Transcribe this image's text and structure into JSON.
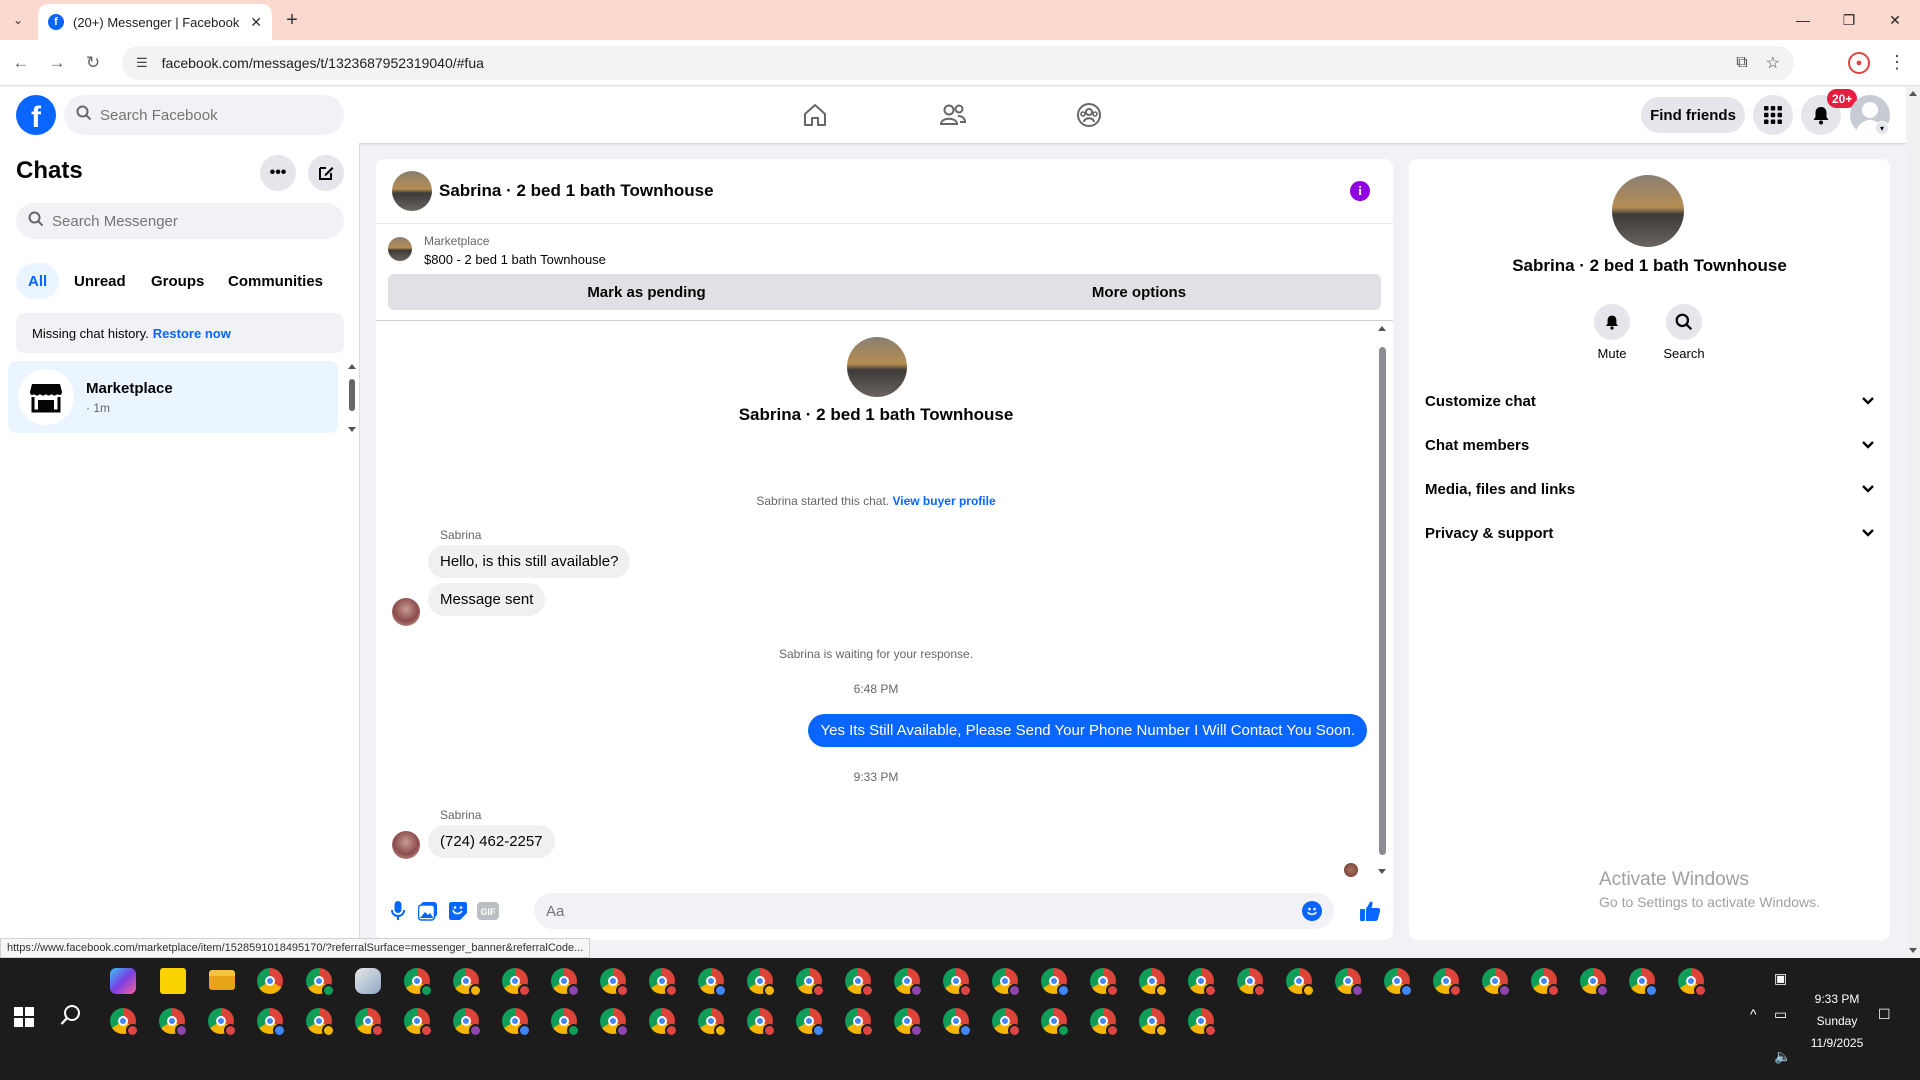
{
  "browser": {
    "tab_title": "(20+) Messenger | Facebook",
    "url": "facebook.com/messages/t/1323687952319040/#fua",
    "status_url": "https://www.facebook.com/marketplace/item/1528591018495170/?referralSurface=messenger_banner&referralCode..."
  },
  "header": {
    "search_placeholder": "Search Facebook",
    "find_friends": "Find friends",
    "notification_count": "20+"
  },
  "sidebar": {
    "title": "Chats",
    "search_placeholder": "Search Messenger",
    "filters": [
      "All",
      "Unread",
      "Groups",
      "Communities"
    ],
    "history_text": "Missing chat history.",
    "history_link": "Restore now",
    "chats": [
      {
        "name": "Marketplace",
        "time": "· 1m"
      }
    ]
  },
  "conversation": {
    "title": "Sabrina · 2 bed 1 bath Townhouse",
    "banner_label": "Marketplace",
    "banner_title": "$800 - 2 bed 1 bath Townhouse",
    "mark_pending": "Mark as pending",
    "more_options": "More options",
    "center_name": "Sabrina · 2 bed 1 bath Townhouse",
    "started_text": "Sabrina started this chat.",
    "view_buyer_profile": "View buyer profile",
    "sender": "Sabrina",
    "msg1": "Hello, is this still available?",
    "msg2": "Message sent",
    "waiting_text": "Sabrina is waiting for your response.",
    "time1": "6:48 PM",
    "outgoing": "Yes Its Still Available, Please Send Your Phone Number I Will Contact You Soon.",
    "time2": "9:33 PM",
    "sender2": "Sabrina",
    "msg3": "(724) 462-2257",
    "composer_placeholder": "Aa"
  },
  "info_panel": {
    "name": "Sabrina · 2 bed 1 bath Townhouse",
    "mute": "Mute",
    "search": "Search",
    "sections": [
      "Customize chat",
      "Chat members",
      "Media, files and links",
      "Privacy & support"
    ]
  },
  "watermark": {
    "line1": "Activate Windows",
    "line2": "Go to Settings to activate Windows."
  },
  "taskbar": {
    "time": "9:33 PM",
    "day": "Sunday",
    "date": "11/9/2025"
  },
  "colors": {
    "accent": "#0866ff",
    "info_purple": "#9000e0",
    "badge_red": "#e41e3f",
    "chrome_tab_strip": "#fbd9cf"
  }
}
